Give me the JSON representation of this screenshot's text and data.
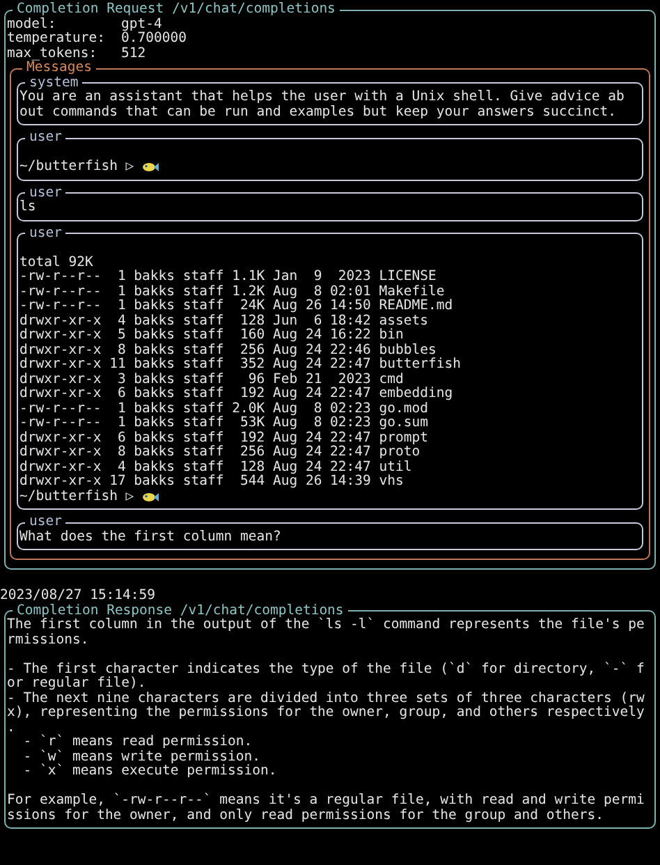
{
  "request": {
    "title": "Completion Request /v1/chat/completions",
    "fields": [
      {
        "label": "model:",
        "value": "gpt-4"
      },
      {
        "label": "temperature:",
        "value": "0.700000"
      },
      {
        "label": "max_tokens:",
        "value": "512"
      }
    ],
    "messages": {
      "title": "Messages",
      "items": [
        {
          "role": "system",
          "lines": [
            {
              "kind": "text",
              "text": "You are an assistant that helps the user with a Unix shell. Give advice ab"
            },
            {
              "kind": "text",
              "text": "out commands that can be run and examples but keep your answers succinct."
            }
          ]
        },
        {
          "role": "user",
          "lines": [
            {
              "kind": "blank"
            },
            {
              "kind": "prompt",
              "text": "~/butterfish ▷"
            }
          ]
        },
        {
          "role": "user",
          "lines": [
            {
              "kind": "text",
              "text": "ls"
            }
          ]
        },
        {
          "role": "user",
          "lines": [
            {
              "kind": "blank"
            },
            {
              "kind": "text",
              "text": "total 92K"
            },
            {
              "kind": "text",
              "text": "-rw-r--r--  1 bakks staff 1.1K Jan  9  2023 LICENSE"
            },
            {
              "kind": "text",
              "text": "-rw-r--r--  1 bakks staff 1.2K Aug  8 02:01 Makefile"
            },
            {
              "kind": "text",
              "text": "-rw-r--r--  1 bakks staff  24K Aug 26 14:50 README.md"
            },
            {
              "kind": "text",
              "text": "drwxr-xr-x  4 bakks staff  128 Jun  6 18:42 assets"
            },
            {
              "kind": "text",
              "text": "drwxr-xr-x  5 bakks staff  160 Aug 24 16:22 bin"
            },
            {
              "kind": "text",
              "text": "drwxr-xr-x  8 bakks staff  256 Aug 24 22:46 bubbles"
            },
            {
              "kind": "text",
              "text": "drwxr-xr-x 11 bakks staff  352 Aug 24 22:47 butterfish"
            },
            {
              "kind": "text",
              "text": "drwxr-xr-x  3 bakks staff   96 Feb 21  2023 cmd"
            },
            {
              "kind": "text",
              "text": "drwxr-xr-x  6 bakks staff  192 Aug 24 22:47 embedding"
            },
            {
              "kind": "text",
              "text": "-rw-r--r--  1 bakks staff 2.0K Aug  8 02:23 go.mod"
            },
            {
              "kind": "text",
              "text": "-rw-r--r--  1 bakks staff  53K Aug  8 02:23 go.sum"
            },
            {
              "kind": "text",
              "text": "drwxr-xr-x  6 bakks staff  192 Aug 24 22:47 prompt"
            },
            {
              "kind": "text",
              "text": "drwxr-xr-x  8 bakks staff  256 Aug 24 22:47 proto"
            },
            {
              "kind": "text",
              "text": "drwxr-xr-x  4 bakks staff  128 Aug 24 22:47 util"
            },
            {
              "kind": "text",
              "text": "drwxr-xr-x 17 bakks staff  544 Aug 26 14:39 vhs"
            },
            {
              "kind": "prompt",
              "text": "~/butterfish ▷"
            }
          ]
        },
        {
          "role": "user",
          "lines": [
            {
              "kind": "text",
              "text": "What does the first column mean?"
            }
          ]
        }
      ]
    }
  },
  "timestamp": "2023/08/27 15:14:59",
  "response": {
    "title": "Completion Response /v1/chat/completions",
    "lines": [
      {
        "kind": "text",
        "text": "The first column in the output of the `ls -l` command represents the file's pe"
      },
      {
        "kind": "text",
        "text": "rmissions."
      },
      {
        "kind": "blank"
      },
      {
        "kind": "text",
        "text": "- The first character indicates the type of the file (`d` for directory, `-` f"
      },
      {
        "kind": "text",
        "text": "or regular file)."
      },
      {
        "kind": "text",
        "text": "- The next nine characters are divided into three sets of three characters (rw"
      },
      {
        "kind": "text",
        "text": "x), representing the permissions for the owner, group, and others respectively"
      },
      {
        "kind": "text",
        "text": "."
      },
      {
        "kind": "text",
        "text": "  - `r` means read permission."
      },
      {
        "kind": "text",
        "text": "  - `w` means write permission."
      },
      {
        "kind": "text",
        "text": "  - `x` means execute permission."
      },
      {
        "kind": "blank"
      },
      {
        "kind": "text",
        "text": "For example, `-rw-r--r--` means it's a regular file, with read and write permi"
      },
      {
        "kind": "text",
        "text": "ssions for the owner, and only read permissions for the group and others."
      }
    ]
  }
}
